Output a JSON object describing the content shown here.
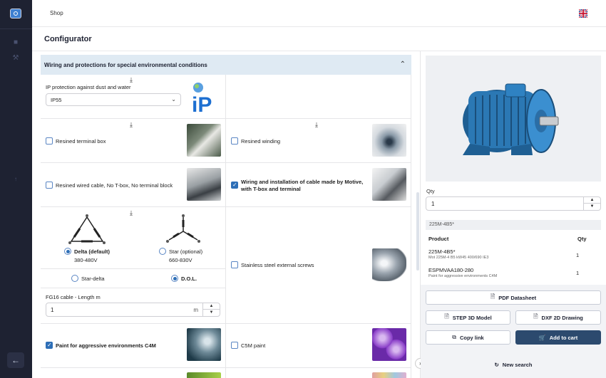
{
  "topbar": {
    "shop_label": "Shop"
  },
  "page": {
    "title": "Configurator"
  },
  "section": {
    "title": "Wiring and protections for special environmental conditions"
  },
  "options": {
    "ip_label": "IP protection against dust and water",
    "ip_value": "IP55",
    "resined_terminal_box": "Resined terminal box",
    "resined_winding": "Resined winding",
    "resined_wired_cable": "Resined wired cable, No T-box, No terminal block",
    "wiring_installation": "Wiring and installation of cable made by Motive, with T-box and terminal",
    "delta_label": "Delta (default)",
    "delta_voltage": "380-480V",
    "star_label": "Star (optional)",
    "star_voltage": "660-830V",
    "star_delta": "Star-delta",
    "dol": "D.O.L.",
    "stainless_screws": "Stainless steel external screws",
    "fg16_label": "FG16 cable - Length m",
    "fg16_value": "1",
    "fg16_unit": "m",
    "paint_c4m": "Paint for aggressive environments C4M",
    "c5m_paint": "C5M paint"
  },
  "product": {
    "qty_label": "Qty",
    "qty_value": "1",
    "code": "225M-4B5*",
    "col_product": "Product",
    "col_qty": "Qty",
    "rows": [
      {
        "name": "225M-4B5*",
        "desc": "Mot 225M-4 B5 kW45 400/690 IE3",
        "qty": "1"
      },
      {
        "name": "ESPMVAA180-280",
        "desc": "Paint for aggressive environments C4M",
        "qty": "1"
      }
    ]
  },
  "actions": {
    "pdf": "PDF Datasheet",
    "step": "STEP 3D Model",
    "dxf": "DXF 2D Drawing",
    "copy": "Copy link",
    "cart": "Add to cart",
    "new_search": "New search"
  },
  "colors": {
    "accent": "#2e6fb7",
    "sidebar": "#1e2232",
    "section_bg": "#dfeaf3",
    "primary_button": "#2c4a6e"
  }
}
